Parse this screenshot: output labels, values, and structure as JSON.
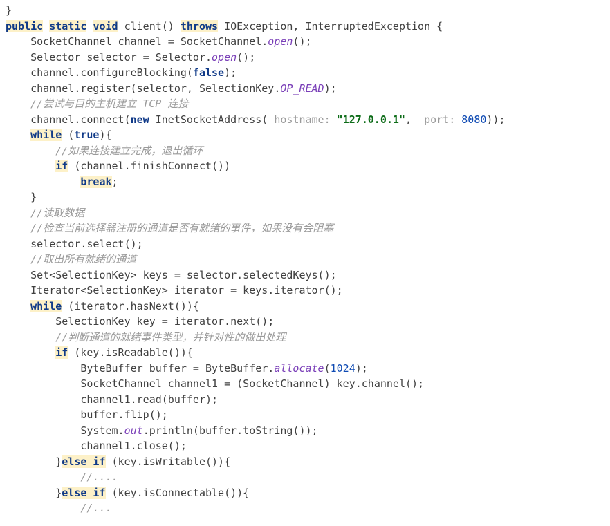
{
  "code": {
    "lines": [
      [
        [
          "p",
          "}"
        ]
      ],
      [
        [
          "khl",
          "public"
        ],
        [
          "p",
          " "
        ],
        [
          "khl",
          "static"
        ],
        [
          "p",
          " "
        ],
        [
          "khl",
          "void"
        ],
        [
          "p",
          " client() "
        ],
        [
          "khl",
          "throws"
        ],
        [
          "p",
          " IOException, InterruptedException {"
        ]
      ],
      [
        [
          "p",
          "    SocketChannel channel = SocketChannel."
        ],
        [
          "fi",
          "open"
        ],
        [
          "p",
          "();"
        ]
      ],
      [
        [
          "p",
          "    Selector selector = Selector."
        ],
        [
          "fi",
          "open"
        ],
        [
          "p",
          "();"
        ]
      ],
      [
        [
          "p",
          "    channel.configureBlocking("
        ],
        [
          "k",
          "false"
        ],
        [
          "p",
          ");"
        ]
      ],
      [
        [
          "p",
          "    channel.register(selector, SelectionKey."
        ],
        [
          "c",
          "OP_READ"
        ],
        [
          "p",
          ");"
        ]
      ],
      [
        [
          "p",
          "    "
        ],
        [
          "com",
          "//尝试与目的主机建立 TCP 连接"
        ]
      ],
      [
        [
          "p",
          "    channel.connect("
        ],
        [
          "k",
          "new"
        ],
        [
          "p",
          " InetSocketAddress( "
        ],
        [
          "param",
          "hostname:"
        ],
        [
          "p",
          " "
        ],
        [
          "s",
          "\"127.0.0.1\""
        ],
        [
          "p",
          ",  "
        ],
        [
          "param",
          "port:"
        ],
        [
          "p",
          " "
        ],
        [
          "n",
          "8080"
        ],
        [
          "p",
          "));"
        ]
      ],
      [
        [
          "p",
          "    "
        ],
        [
          "khl",
          "while"
        ],
        [
          "p",
          " ("
        ],
        [
          "k",
          "true"
        ],
        [
          "p",
          "){"
        ]
      ],
      [
        [
          "p",
          "        "
        ],
        [
          "com",
          "//如果连接建立完成，退出循环"
        ]
      ],
      [
        [
          "p",
          "        "
        ],
        [
          "khl",
          "if"
        ],
        [
          "p",
          " (channel.finishConnect())"
        ]
      ],
      [
        [
          "p",
          "            "
        ],
        [
          "khl",
          "break"
        ],
        [
          "p",
          ";"
        ]
      ],
      [
        [
          "p",
          "    }"
        ]
      ],
      [
        [
          "p",
          "    "
        ],
        [
          "com",
          "//读取数据"
        ]
      ],
      [
        [
          "p",
          "    "
        ],
        [
          "com",
          "//检查当前选择器注册的通道是否有就绪的事件，如果没有会阻塞"
        ]
      ],
      [
        [
          "p",
          "    selector.select();"
        ]
      ],
      [
        [
          "p",
          "    "
        ],
        [
          "com",
          "//取出所有就绪的通道"
        ]
      ],
      [
        [
          "p",
          "    Set<SelectionKey> keys = selector.selectedKeys();"
        ]
      ],
      [
        [
          "p",
          "    Iterator<SelectionKey> iterator = keys.iterator();"
        ]
      ],
      [
        [
          "p",
          "    "
        ],
        [
          "khl",
          "while"
        ],
        [
          "p",
          " (iterator.hasNext()){"
        ]
      ],
      [
        [
          "p",
          "        SelectionKey key = iterator.next();"
        ]
      ],
      [
        [
          "p",
          "        "
        ],
        [
          "com",
          "//判断通道的就绪事件类型，并针对性的做出处理"
        ]
      ],
      [
        [
          "p",
          "        "
        ],
        [
          "khl",
          "if"
        ],
        [
          "p",
          " (key.isReadable()){"
        ]
      ],
      [
        [
          "p",
          "            ByteBuffer buffer = ByteBuffer."
        ],
        [
          "fi",
          "allocate"
        ],
        [
          "p",
          "("
        ],
        [
          "n",
          "1024"
        ],
        [
          "p",
          ");"
        ]
      ],
      [
        [
          "p",
          "            SocketChannel channel1 = (SocketChannel) key.channel();"
        ]
      ],
      [
        [
          "p",
          "            channel1.read(buffer);"
        ]
      ],
      [
        [
          "p",
          "            buffer.flip();"
        ]
      ],
      [
        [
          "p",
          "            System."
        ],
        [
          "c",
          "out"
        ],
        [
          "p",
          ".println(buffer.toString());"
        ]
      ],
      [
        [
          "p",
          "            channel1.close();"
        ]
      ],
      [
        [
          "p",
          "        }"
        ],
        [
          "khl",
          "else if"
        ],
        [
          "p",
          " (key.isWritable()){"
        ]
      ],
      [
        [
          "p",
          "            "
        ],
        [
          "com",
          "//...."
        ]
      ],
      [
        [
          "p",
          "        }"
        ],
        [
          "khl",
          "else if"
        ],
        [
          "p",
          " (key.isConnectable()){"
        ]
      ],
      [
        [
          "p",
          "            "
        ],
        [
          "com",
          "//..."
        ]
      ]
    ]
  }
}
